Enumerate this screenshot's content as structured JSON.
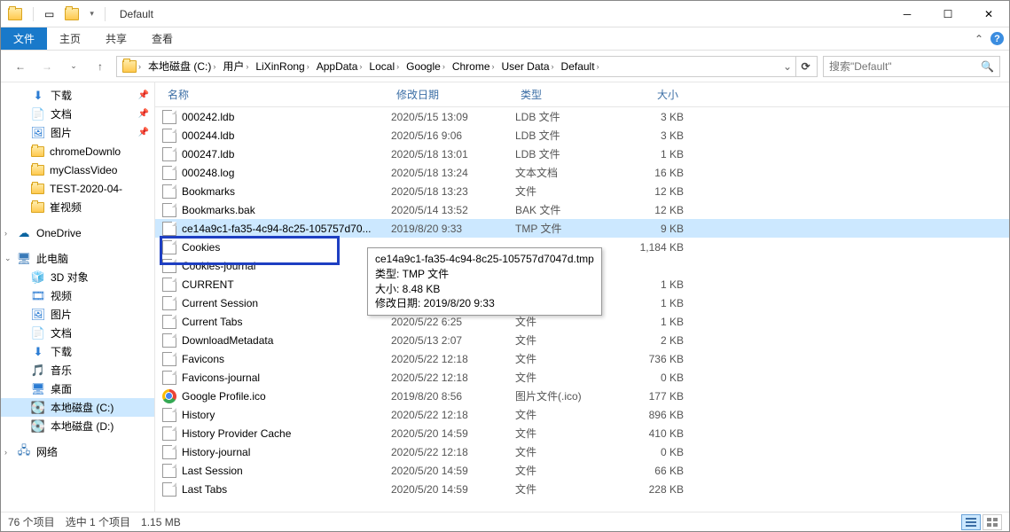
{
  "window": {
    "title": "Default"
  },
  "ribbon": {
    "file": "文件",
    "home": "主页",
    "share": "共享",
    "view": "查看"
  },
  "breadcrumb": {
    "segments": [
      "本地磁盘 (C:)",
      "用户",
      "LiXinRong",
      "AppData",
      "Local",
      "Google",
      "Chrome",
      "User Data",
      "Default"
    ]
  },
  "search": {
    "placeholder": "搜索\"Default\""
  },
  "sidebar": {
    "quick": [
      {
        "label": "下载",
        "icon": "download",
        "pinned": true
      },
      {
        "label": "文档",
        "icon": "doc",
        "pinned": true
      },
      {
        "label": "图片",
        "icon": "pic",
        "pinned": true
      },
      {
        "label": "chromeDownlo",
        "icon": "folder"
      },
      {
        "label": "myClassVideo",
        "icon": "folder"
      },
      {
        "label": "TEST-2020-04-",
        "icon": "folder"
      },
      {
        "label": "崔视频",
        "icon": "folder"
      }
    ],
    "onedrive": "OneDrive",
    "thispc": "此电脑",
    "thispc_items": [
      {
        "label": "3D 对象",
        "icon": "3d"
      },
      {
        "label": "视频",
        "icon": "video"
      },
      {
        "label": "图片",
        "icon": "pic"
      },
      {
        "label": "文档",
        "icon": "doc"
      },
      {
        "label": "下载",
        "icon": "download"
      },
      {
        "label": "音乐",
        "icon": "music"
      },
      {
        "label": "桌面",
        "icon": "desktop"
      },
      {
        "label": "本地磁盘 (C:)",
        "icon": "drive",
        "selected": true
      },
      {
        "label": "本地磁盘 (D:)",
        "icon": "drive"
      }
    ],
    "network": "网络"
  },
  "columns": {
    "name": "名称",
    "date": "修改日期",
    "type": "类型",
    "size": "大小"
  },
  "files": [
    {
      "name": "000242.ldb",
      "date": "2020/5/15 13:09",
      "type": "LDB 文件",
      "size": "3 KB",
      "icon": "file"
    },
    {
      "name": "000244.ldb",
      "date": "2020/5/16 9:06",
      "type": "LDB 文件",
      "size": "3 KB",
      "icon": "file"
    },
    {
      "name": "000247.ldb",
      "date": "2020/5/18 13:01",
      "type": "LDB 文件",
      "size": "1 KB",
      "icon": "file"
    },
    {
      "name": "000248.log",
      "date": "2020/5/18 13:24",
      "type": "文本文档",
      "size": "16 KB",
      "icon": "file"
    },
    {
      "name": "Bookmarks",
      "date": "2020/5/18 13:23",
      "type": "文件",
      "size": "12 KB",
      "icon": "file"
    },
    {
      "name": "Bookmarks.bak",
      "date": "2020/5/14 13:52",
      "type": "BAK 文件",
      "size": "12 KB",
      "icon": "file"
    },
    {
      "name": "ce14a9c1-fa35-4c94-8c25-105757d70...",
      "date": "2019/8/20 9:33",
      "type": "TMP 文件",
      "size": "9 KB",
      "icon": "file",
      "selected": true
    },
    {
      "name": "Cookies",
      "date": "",
      "type": "",
      "size": "1,184 KB",
      "icon": "file",
      "highlighted": true
    },
    {
      "name": "Cookies-journal",
      "date": "",
      "type": "",
      "size": "",
      "icon": "file"
    },
    {
      "name": "CURRENT",
      "date": "",
      "type": "",
      "size": "1 KB",
      "icon": "file"
    },
    {
      "name": "Current Session",
      "date": "",
      "type": "",
      "size": "1 KB",
      "icon": "file"
    },
    {
      "name": "Current Tabs",
      "date": "2020/5/22 6:25",
      "type": "文件",
      "size": "1 KB",
      "icon": "file"
    },
    {
      "name": "DownloadMetadata",
      "date": "2020/5/13 2:07",
      "type": "文件",
      "size": "2 KB",
      "icon": "file"
    },
    {
      "name": "Favicons",
      "date": "2020/5/22 12:18",
      "type": "文件",
      "size": "736 KB",
      "icon": "file"
    },
    {
      "name": "Favicons-journal",
      "date": "2020/5/22 12:18",
      "type": "文件",
      "size": "0 KB",
      "icon": "file"
    },
    {
      "name": "Google Profile.ico",
      "date": "2019/8/20 8:56",
      "type": "图片文件(.ico)",
      "size": "177 KB",
      "icon": "chrome"
    },
    {
      "name": "History",
      "date": "2020/5/22 12:18",
      "type": "文件",
      "size": "896 KB",
      "icon": "file"
    },
    {
      "name": "History Provider Cache",
      "date": "2020/5/20 14:59",
      "type": "文件",
      "size": "410 KB",
      "icon": "file"
    },
    {
      "name": "History-journal",
      "date": "2020/5/22 12:18",
      "type": "文件",
      "size": "0 KB",
      "icon": "file"
    },
    {
      "name": "Last Session",
      "date": "2020/5/20 14:59",
      "type": "文件",
      "size": "66 KB",
      "icon": "file"
    },
    {
      "name": "Last Tabs",
      "date": "2020/5/20 14:59",
      "type": "文件",
      "size": "228 KB",
      "icon": "file"
    }
  ],
  "tooltip": {
    "line1": "ce14a9c1-fa35-4c94-8c25-105757d7047d.tmp",
    "line2": "类型: TMP 文件",
    "line3": "大小: 8.48 KB",
    "line4": "修改日期: 2019/8/20 9:33"
  },
  "statusbar": {
    "count": "76 个项目",
    "selection": "选中 1 个项目",
    "size": "1.15 MB"
  }
}
